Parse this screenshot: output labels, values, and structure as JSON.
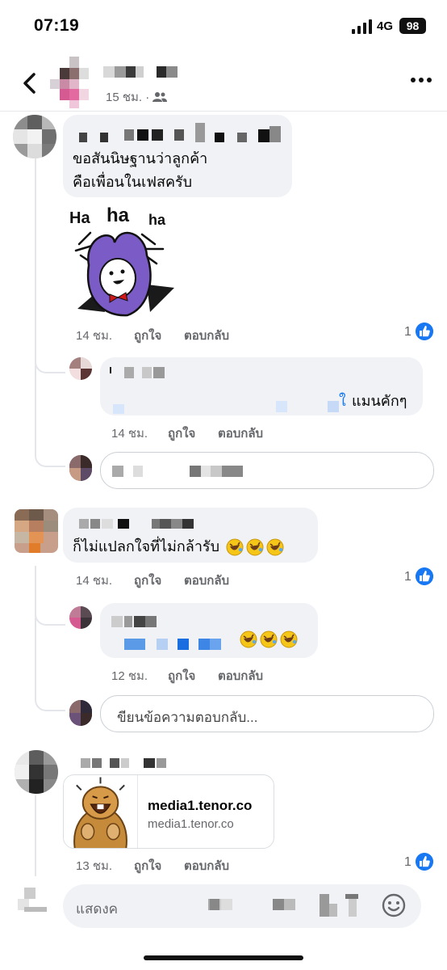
{
  "status_bar": {
    "time": "07:19",
    "network": "4G",
    "battery": "98"
  },
  "header": {
    "post_time": "15 ชม. ·"
  },
  "comments": [
    {
      "text_line1": "ขอสันนิษฐานว่าลูกค้า",
      "text_line2": "คือเพื่อนในเฟสครับ",
      "sticker_text": "Ha ha ha",
      "time": "14 ชม.",
      "like_label": "ถูกใจ",
      "reply_label": "ตอบกลับ",
      "reaction_count": "1",
      "replies": [
        {
          "text_tail": "แมนคักๆ",
          "time": "14 ชม.",
          "like_label": "ถูกใจ",
          "reply_label": "ตอบกลับ"
        }
      ]
    },
    {
      "text": "ก็ไม่แปลกใจที่ไม่กล้ารับ",
      "time": "14 ชม.",
      "like_label": "ถูกใจ",
      "reply_label": "ตอบกลับ",
      "reaction_count": "1",
      "replies": [
        {
          "time": "12 ชม.",
          "like_label": "ถูกใจ",
          "reply_label": "ตอบกลับ"
        }
      ],
      "reply_placeholder": "ขียนข้อความตอบกลับ..."
    },
    {
      "link_title": "media1.tenor.co",
      "link_domain": "media1.tenor.co",
      "time": "13 ชม.",
      "like_label": "ถูกใจ",
      "reply_label": "ตอบกลับ",
      "reaction_count": "1"
    }
  ],
  "composer": {
    "placeholder": "แสดงค"
  },
  "colors": {
    "accent": "#1877f2",
    "bubble": "#f0f2f5",
    "meta": "#65676b",
    "emoji": "#f5c518"
  }
}
